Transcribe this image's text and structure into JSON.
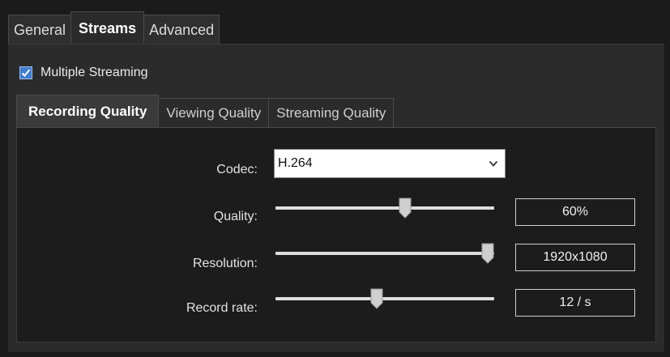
{
  "top_tabs": [
    {
      "label": "General",
      "active": false
    },
    {
      "label": "Streams",
      "active": true
    },
    {
      "label": "Advanced",
      "active": false
    }
  ],
  "multiple_streaming": {
    "label": "Multiple Streaming",
    "checked": true
  },
  "inner_tabs": [
    {
      "label": "Recording Quality",
      "active": true
    },
    {
      "label": "Viewing Quality",
      "active": false
    },
    {
      "label": "Streaming Quality",
      "active": false
    }
  ],
  "form": {
    "codec": {
      "label": "Codec:",
      "value": "H.264"
    },
    "quality": {
      "label": "Quality:",
      "value_text": "60%",
      "slider_fraction": 0.6
    },
    "resolution": {
      "label": "Resolution:",
      "value_text": "1920x1080",
      "slider_fraction": 1.0
    },
    "record_rate": {
      "label": "Record rate:",
      "value_text": "12 / s",
      "slider_fraction": 0.46
    }
  },
  "colors": {
    "checkbox_fill": "#3d7fd1",
    "background": "#1b1b1b"
  }
}
